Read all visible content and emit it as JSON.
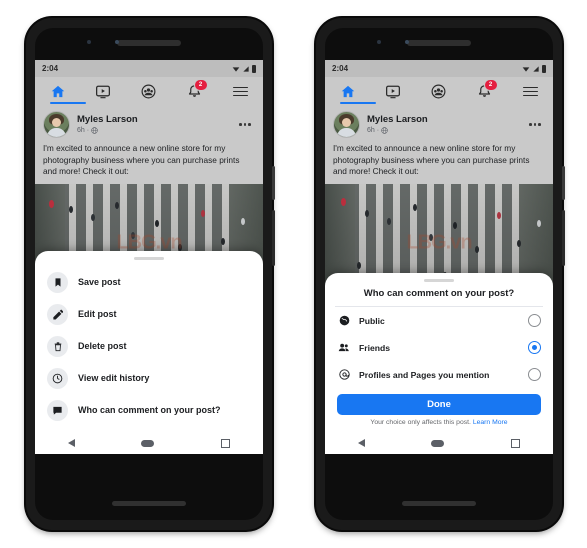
{
  "meta": {
    "background_color": "#ffffff",
    "accent_color": "#1877f2",
    "badge_color": "#e41e3f",
    "watermark_text": "LBG.vn"
  },
  "status_bar": {
    "time": "2:04",
    "icons": [
      "wifi-icon",
      "signal-icon",
      "battery-icon"
    ]
  },
  "top_nav": {
    "items": [
      {
        "name": "home",
        "icon": "home-icon",
        "active": true,
        "badge": ""
      },
      {
        "name": "video",
        "icon": "video-icon",
        "active": false,
        "badge": ""
      },
      {
        "name": "groups",
        "icon": "groups-icon",
        "active": false,
        "badge": ""
      },
      {
        "name": "notifications",
        "icon": "bell-icon",
        "active": false,
        "badge": "2"
      },
      {
        "name": "menu",
        "icon": "hamburger-icon",
        "active": false,
        "badge": ""
      }
    ]
  },
  "post": {
    "author": "Myles Larson",
    "time": "6h",
    "separator": "·",
    "audience_icon": "globe-icon",
    "more_icon": "more-options-icon",
    "body": "I'm excited to announce a new online store for my photography business where you can purchase prints and more! Check it out:"
  },
  "left_phone": {
    "sheet": {
      "items": [
        {
          "icon": "bookmark-icon",
          "label": "Save post"
        },
        {
          "icon": "pencil-icon",
          "label": "Edit post"
        },
        {
          "icon": "trash-icon",
          "label": "Delete post"
        },
        {
          "icon": "edit-history-icon",
          "label": "View edit history"
        },
        {
          "icon": "comment-bubble-icon",
          "label": "Who can comment on your post?"
        }
      ]
    }
  },
  "right_phone": {
    "dialog": {
      "title": "Who can comment on your post?",
      "options": [
        {
          "icon": "globe-icon",
          "label": "Public",
          "selected": false
        },
        {
          "icon": "friends-icon",
          "label": "Friends",
          "selected": true
        },
        {
          "icon": "at-mention-icon",
          "label": "Profiles and Pages you mention",
          "selected": false
        }
      ],
      "primary_button": "Done",
      "hint_text": "Your choice only affects this post.",
      "hint_link": "Learn More"
    }
  },
  "android_nav": {
    "back": "back-button",
    "home": "home-button",
    "recents": "recents-button"
  }
}
